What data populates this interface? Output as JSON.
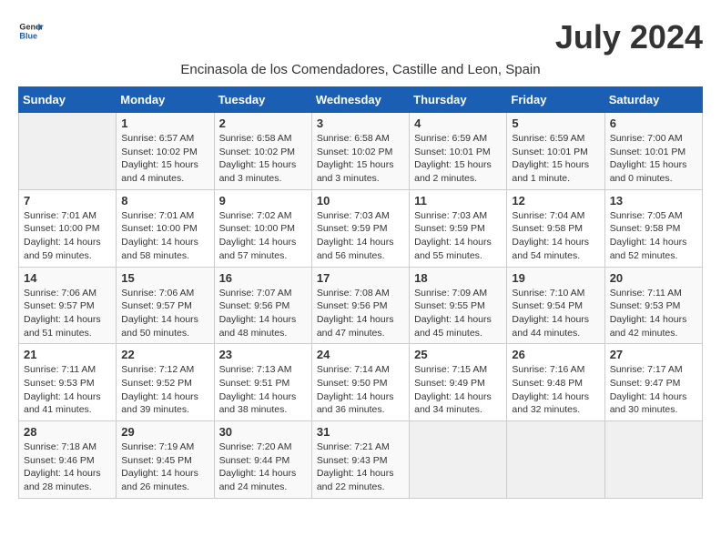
{
  "header": {
    "logo_line1": "General",
    "logo_line2": "Blue",
    "month_year": "July 2024",
    "subtitle": "Encinasola de los Comendadores, Castille and Leon, Spain"
  },
  "days_of_week": [
    "Sunday",
    "Monday",
    "Tuesday",
    "Wednesday",
    "Thursday",
    "Friday",
    "Saturday"
  ],
  "weeks": [
    [
      {
        "day": "",
        "sunrise": "",
        "sunset": "",
        "daylight": ""
      },
      {
        "day": "1",
        "sunrise": "Sunrise: 6:57 AM",
        "sunset": "Sunset: 10:02 PM",
        "daylight": "Daylight: 15 hours and 4 minutes."
      },
      {
        "day": "2",
        "sunrise": "Sunrise: 6:58 AM",
        "sunset": "Sunset: 10:02 PM",
        "daylight": "Daylight: 15 hours and 3 minutes."
      },
      {
        "day": "3",
        "sunrise": "Sunrise: 6:58 AM",
        "sunset": "Sunset: 10:02 PM",
        "daylight": "Daylight: 15 hours and 3 minutes."
      },
      {
        "day": "4",
        "sunrise": "Sunrise: 6:59 AM",
        "sunset": "Sunset: 10:01 PM",
        "daylight": "Daylight: 15 hours and 2 minutes."
      },
      {
        "day": "5",
        "sunrise": "Sunrise: 6:59 AM",
        "sunset": "Sunset: 10:01 PM",
        "daylight": "Daylight: 15 hours and 1 minute."
      },
      {
        "day": "6",
        "sunrise": "Sunrise: 7:00 AM",
        "sunset": "Sunset: 10:01 PM",
        "daylight": "Daylight: 15 hours and 0 minutes."
      }
    ],
    [
      {
        "day": "7",
        "sunrise": "Sunrise: 7:01 AM",
        "sunset": "Sunset: 10:00 PM",
        "daylight": "Daylight: 14 hours and 59 minutes."
      },
      {
        "day": "8",
        "sunrise": "Sunrise: 7:01 AM",
        "sunset": "Sunset: 10:00 PM",
        "daylight": "Daylight: 14 hours and 58 minutes."
      },
      {
        "day": "9",
        "sunrise": "Sunrise: 7:02 AM",
        "sunset": "Sunset: 10:00 PM",
        "daylight": "Daylight: 14 hours and 57 minutes."
      },
      {
        "day": "10",
        "sunrise": "Sunrise: 7:03 AM",
        "sunset": "Sunset: 9:59 PM",
        "daylight": "Daylight: 14 hours and 56 minutes."
      },
      {
        "day": "11",
        "sunrise": "Sunrise: 7:03 AM",
        "sunset": "Sunset: 9:59 PM",
        "daylight": "Daylight: 14 hours and 55 minutes."
      },
      {
        "day": "12",
        "sunrise": "Sunrise: 7:04 AM",
        "sunset": "Sunset: 9:58 PM",
        "daylight": "Daylight: 14 hours and 54 minutes."
      },
      {
        "day": "13",
        "sunrise": "Sunrise: 7:05 AM",
        "sunset": "Sunset: 9:58 PM",
        "daylight": "Daylight: 14 hours and 52 minutes."
      }
    ],
    [
      {
        "day": "14",
        "sunrise": "Sunrise: 7:06 AM",
        "sunset": "Sunset: 9:57 PM",
        "daylight": "Daylight: 14 hours and 51 minutes."
      },
      {
        "day": "15",
        "sunrise": "Sunrise: 7:06 AM",
        "sunset": "Sunset: 9:57 PM",
        "daylight": "Daylight: 14 hours and 50 minutes."
      },
      {
        "day": "16",
        "sunrise": "Sunrise: 7:07 AM",
        "sunset": "Sunset: 9:56 PM",
        "daylight": "Daylight: 14 hours and 48 minutes."
      },
      {
        "day": "17",
        "sunrise": "Sunrise: 7:08 AM",
        "sunset": "Sunset: 9:56 PM",
        "daylight": "Daylight: 14 hours and 47 minutes."
      },
      {
        "day": "18",
        "sunrise": "Sunrise: 7:09 AM",
        "sunset": "Sunset: 9:55 PM",
        "daylight": "Daylight: 14 hours and 45 minutes."
      },
      {
        "day": "19",
        "sunrise": "Sunrise: 7:10 AM",
        "sunset": "Sunset: 9:54 PM",
        "daylight": "Daylight: 14 hours and 44 minutes."
      },
      {
        "day": "20",
        "sunrise": "Sunrise: 7:11 AM",
        "sunset": "Sunset: 9:53 PM",
        "daylight": "Daylight: 14 hours and 42 minutes."
      }
    ],
    [
      {
        "day": "21",
        "sunrise": "Sunrise: 7:11 AM",
        "sunset": "Sunset: 9:53 PM",
        "daylight": "Daylight: 14 hours and 41 minutes."
      },
      {
        "day": "22",
        "sunrise": "Sunrise: 7:12 AM",
        "sunset": "Sunset: 9:52 PM",
        "daylight": "Daylight: 14 hours and 39 minutes."
      },
      {
        "day": "23",
        "sunrise": "Sunrise: 7:13 AM",
        "sunset": "Sunset: 9:51 PM",
        "daylight": "Daylight: 14 hours and 38 minutes."
      },
      {
        "day": "24",
        "sunrise": "Sunrise: 7:14 AM",
        "sunset": "Sunset: 9:50 PM",
        "daylight": "Daylight: 14 hours and 36 minutes."
      },
      {
        "day": "25",
        "sunrise": "Sunrise: 7:15 AM",
        "sunset": "Sunset: 9:49 PM",
        "daylight": "Daylight: 14 hours and 34 minutes."
      },
      {
        "day": "26",
        "sunrise": "Sunrise: 7:16 AM",
        "sunset": "Sunset: 9:48 PM",
        "daylight": "Daylight: 14 hours and 32 minutes."
      },
      {
        "day": "27",
        "sunrise": "Sunrise: 7:17 AM",
        "sunset": "Sunset: 9:47 PM",
        "daylight": "Daylight: 14 hours and 30 minutes."
      }
    ],
    [
      {
        "day": "28",
        "sunrise": "Sunrise: 7:18 AM",
        "sunset": "Sunset: 9:46 PM",
        "daylight": "Daylight: 14 hours and 28 minutes."
      },
      {
        "day": "29",
        "sunrise": "Sunrise: 7:19 AM",
        "sunset": "Sunset: 9:45 PM",
        "daylight": "Daylight: 14 hours and 26 minutes."
      },
      {
        "day": "30",
        "sunrise": "Sunrise: 7:20 AM",
        "sunset": "Sunset: 9:44 PM",
        "daylight": "Daylight: 14 hours and 24 minutes."
      },
      {
        "day": "31",
        "sunrise": "Sunrise: 7:21 AM",
        "sunset": "Sunset: 9:43 PM",
        "daylight": "Daylight: 14 hours and 22 minutes."
      },
      {
        "day": "",
        "sunrise": "",
        "sunset": "",
        "daylight": ""
      },
      {
        "day": "",
        "sunrise": "",
        "sunset": "",
        "daylight": ""
      },
      {
        "day": "",
        "sunrise": "",
        "sunset": "",
        "daylight": ""
      }
    ]
  ]
}
